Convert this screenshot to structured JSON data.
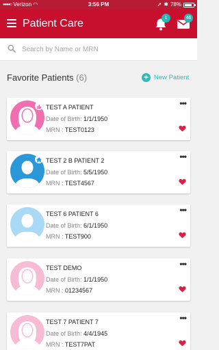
{
  "status": {
    "carrier": "Verizon",
    "time": "3:56 PM",
    "battery": "78%",
    "battery_level": 0.78
  },
  "header": {
    "title": "Patient Care",
    "notifications_count": "1",
    "messages_count": "46"
  },
  "search": {
    "placeholder": "Search by Name or MRN"
  },
  "favorites": {
    "title": "Favorite Patients",
    "count": "(6)",
    "new_patient_label": "New Patient",
    "dob_label": "Date of Birth:",
    "mrn_label": "MRN :"
  },
  "patients": [
    {
      "name": "TEST A PATIENT",
      "dob": "1/1/1950",
      "mrn": "TEST0123",
      "avatar": "female",
      "avatar_color": "#f06fb0",
      "tag": "thumbs-up-icon",
      "tag_color": "#f06fb0"
    },
    {
      "name": "TEST 2 B PATIENT 2",
      "dob": "5/5/1950",
      "mrn": "TEST4567",
      "avatar": "male",
      "avatar_color": "#2a97d9",
      "tag": "home-icon",
      "tag_color": "#2a97d9"
    },
    {
      "name": "TEST 6 PATIENT 6",
      "dob": "6/1/1950",
      "mrn": "TEST900",
      "avatar": "neutral",
      "avatar_color": "#a9d9f4"
    },
    {
      "name": "TEST DEMO",
      "dob": "1/1/1950",
      "mrn": "01234567",
      "avatar": "female",
      "avatar_color": "#f7bcd5"
    },
    {
      "name": "TEST 7 PATIENT 7",
      "dob": "4/4/1945",
      "mrn": "TEST7PAT",
      "avatar": "female",
      "avatar_color": "#f7bcd5"
    }
  ],
  "colors": {
    "brand": "#c8102e",
    "accent": "#2bbcb8",
    "heart": "#d8204a"
  }
}
